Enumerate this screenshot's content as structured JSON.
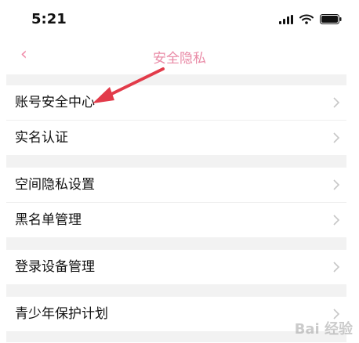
{
  "status": {
    "time": "5:21"
  },
  "nav": {
    "back_label": "‹",
    "title": "安全隐私"
  },
  "groups": [
    {
      "items": [
        {
          "label": "账号安全中心"
        },
        {
          "label": "实名认证"
        }
      ]
    },
    {
      "items": [
        {
          "label": "空间隐私设置"
        },
        {
          "label": "黑名单管理"
        }
      ]
    },
    {
      "items": [
        {
          "label": "登录设备管理"
        }
      ]
    },
    {
      "items": [
        {
          "label": "青少年保护计划"
        }
      ]
    }
  ],
  "colors": {
    "accent": "#e98aa6",
    "annotation_arrow": "#e23b4a",
    "separator": "#f2f2f2"
  },
  "watermark": "Bai 经验"
}
